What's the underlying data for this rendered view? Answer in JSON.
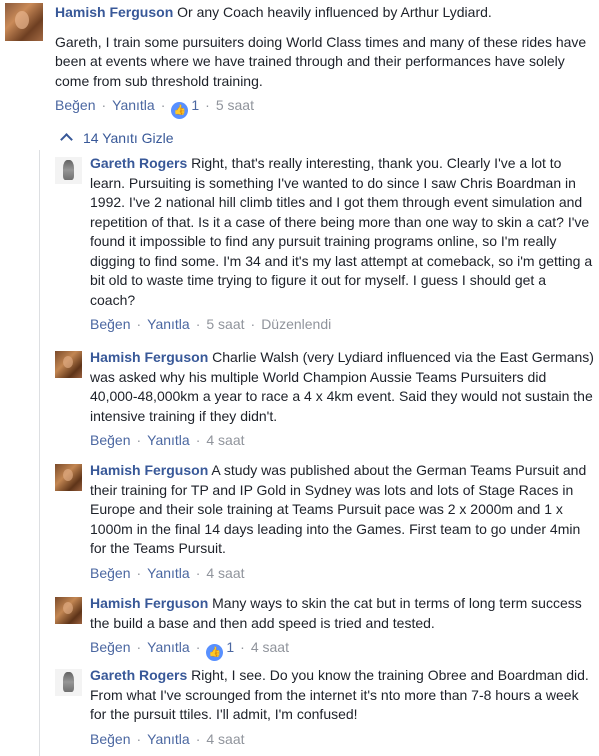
{
  "top_comment": {
    "author": "Hamish Ferguson",
    "text_1": "Or any Coach heavily influenced by Arthur Lydiard.",
    "text_2": "Gareth, I train some pursuiters doing World Class times and many of these rides have been at events where we have trained through and their performances have solely come from sub threshold training.",
    "like_label": "Beğen",
    "reply_label": "Yanıtla",
    "reaction_count": "1",
    "time": "5 saat"
  },
  "hide_replies_label": "14 Yanıtı Gizle",
  "replies": [
    {
      "author": "Gareth Rogers",
      "text": "Right, that's really interesting, thank you. Clearly I've a lot to learn. Pursuiting is something I've wanted to do since I saw Chris Boardman in 1992. I've 2 national hill climb titles and I got them through event simulation and repetition of that. Is it a case of there being more than one way to skin a cat? I've found it impossible to find any pursuit training programs online, so I'm really digging to find some. I'm 34 and it's my last attempt at comeback, so i'm getting a bit old to waste time trying to figure it out for myself. I guess I should get a coach?",
      "like_label": "Beğen",
      "reply_label": "Yanıtla",
      "time": "5 saat",
      "edited_label": "Düzenlendi"
    },
    {
      "author": "Hamish Ferguson",
      "text": "Charlie Walsh (very Lydiard influenced via the East Germans) was asked why his multiple World Champion Aussie Teams Pursuiters did 40,000-48,000km a year to race a 4 x 4km event. Said they would not sustain the intensive training if they didn't.",
      "like_label": "Beğen",
      "reply_label": "Yanıtla",
      "time": "4 saat"
    },
    {
      "author": "Hamish Ferguson",
      "text": "A study was published about the German Teams Pursuit and their training for TP and IP Gold in Sydney was lots and lots of Stage Races in Europe and their sole training at Teams Pursuit pace was 2 x 2000m and 1 x 1000m in the final 14 days leading into the Games. First team to go under 4min for the Teams Pursuit.",
      "like_label": "Beğen",
      "reply_label": "Yanıtla",
      "time": "4 saat"
    },
    {
      "author": "Hamish Ferguson",
      "text": "Many ways to skin the cat but in terms of long term success the build a base and then add speed is tried and tested.",
      "like_label": "Beğen",
      "reply_label": "Yanıtla",
      "reaction_count": "1",
      "time": "4 saat"
    },
    {
      "author": "Gareth Rogers",
      "text": "Right, I see. Do you know the training Obree and Boardman did. From what I've scrounged from the internet it's nto more than 7-8 hours a week for the pursuit ttiles. I'll admit, I'm confused!",
      "like_label": "Beğen",
      "reply_label": "Yanıtla",
      "time": "4 saat"
    }
  ]
}
